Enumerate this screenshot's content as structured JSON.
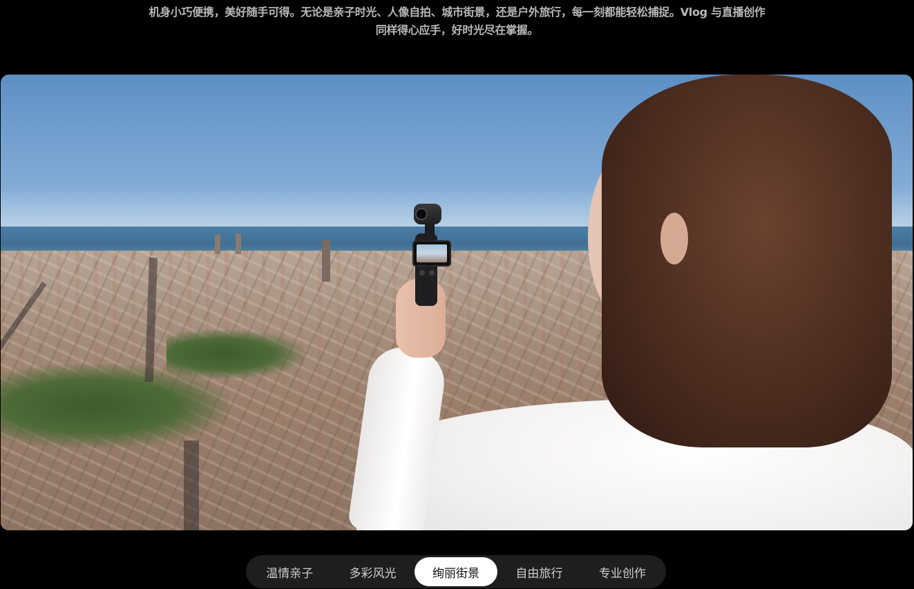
{
  "intro": {
    "line1": "机身小巧便携，美好随手可得。无论是亲子时光、人像自拍、城市街景，还是户外旅行，每一刻都能轻松捕捉。Vlog 与直播创作",
    "line2": "同样得心应手，好时光尽在掌握。"
  },
  "tabs": [
    {
      "label": "温情亲子",
      "active": false
    },
    {
      "label": "多彩风光",
      "active": false
    },
    {
      "label": "绚丽街景",
      "active": true
    },
    {
      "label": "自由旅行",
      "active": false
    },
    {
      "label": "专业创作",
      "active": false
    }
  ],
  "colors": {
    "background": "#000000",
    "intro_text": "#b8b8b8",
    "tabbar_bg": "#1e1e1e",
    "tab_active_bg": "#ffffff",
    "tab_active_text": "#111111",
    "tab_text": "#cfcfcf"
  }
}
